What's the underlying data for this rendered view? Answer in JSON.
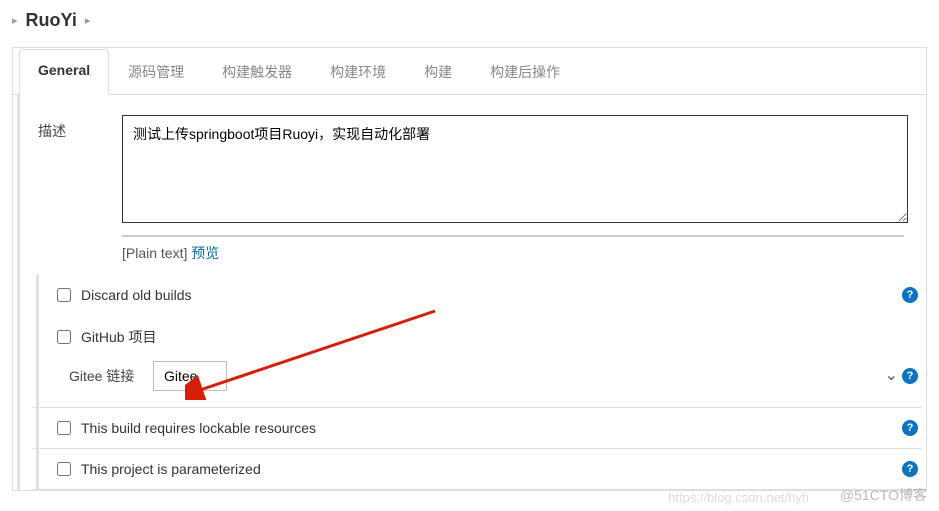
{
  "breadcrumb": {
    "title": "RuoYi"
  },
  "tabs": {
    "general": "General",
    "scm": "源码管理",
    "triggers": "构建触发器",
    "env": "构建环境",
    "build": "构建",
    "postbuild": "构建后操作"
  },
  "desc": {
    "label": "描述",
    "value": "测试上传springboot项目Ruoyi，实现自动化部署",
    "plainText": "[Plain text]",
    "preview": "预览"
  },
  "checks": {
    "discard": "Discard old builds",
    "github": "GitHub 项目",
    "lockable": "This build requires lockable resources",
    "param": "This project is parameterized"
  },
  "gitee": {
    "label": "Gitee 链接",
    "selected": "Gitee"
  },
  "watermark": {
    "a": "https://blog.csdn.net/hyh",
    "b": "@51CTO博客"
  }
}
